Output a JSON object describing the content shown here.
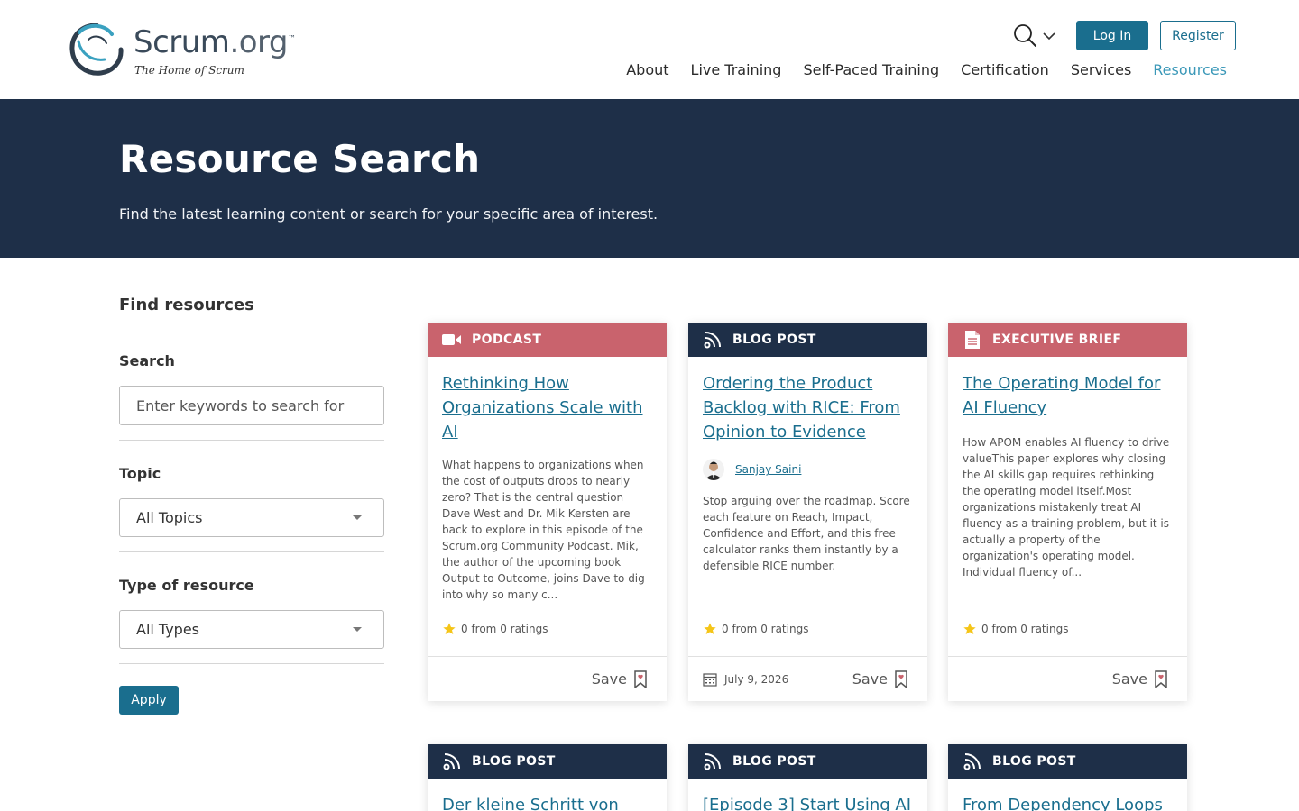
{
  "header": {
    "logo": {
      "brand": "Scrum",
      "suffix": ".org",
      "tm": "™",
      "tagline": "The Home of Scrum"
    },
    "login_label": "Log In",
    "register_label": "Register",
    "nav": [
      {
        "label": "About"
      },
      {
        "label": "Live Training"
      },
      {
        "label": "Self-Paced Training"
      },
      {
        "label": "Certification"
      },
      {
        "label": "Services"
      },
      {
        "label": "Resources",
        "active": true
      }
    ]
  },
  "hero": {
    "title": "Resource Search",
    "subtitle": "Find the latest learning content or search for your specific area of interest."
  },
  "sidebar": {
    "title": "Find resources",
    "search_label": "Search",
    "search_placeholder": "Enter keywords to search for",
    "topic_label": "Topic",
    "topic_value": "All Topics",
    "type_label": "Type of resource",
    "type_value": "All Types",
    "apply_label": "Apply"
  },
  "cards": [
    {
      "type": "PODCAST",
      "icon": "video-camera-icon",
      "title": "Rethinking How Organizations Scale with AI",
      "description": "What happens to organizations when the cost of outputs drops to nearly zero? That is the central question Dave West and Dr. Mik Kersten are back to explore in this episode of the Scrum.org Community Podcast. Mik, the author of the upcoming book Output to Outcome, joins Dave to dig into why so many c...",
      "rating": "0 from 0 ratings",
      "save_label": "Save"
    },
    {
      "type": "BLOG POST",
      "icon": "rss-icon",
      "title": "Ordering the Product Backlog with RICE: From Opinion to Evidence",
      "author": "Sanjay Saini",
      "description": "Stop arguing over the roadmap. Score each feature on Reach, Impact, Confidence and Effort, and this free calculator ranks them instantly by a defensible RICE number.",
      "rating": "0 from 0 ratings",
      "date": "July 9, 2026",
      "save_label": "Save"
    },
    {
      "type": "EXECUTIVE BRIEF",
      "icon": "document-icon",
      "title": "The Operating Model for AI Fluency",
      "description": "How APOM enables AI fluency to drive valueThis paper explores why closing the AI skills gap requires rethinking the operating model itself.Most organizations mistakenly treat AI fluency as a training problem, but it is actually a property of the organization's operating model. Individual fluency of...",
      "rating": "0 from 0 ratings",
      "save_label": "Save"
    },
    {
      "type": "BLOG POST",
      "icon": "rss-icon",
      "title": "Der kleine Schritt von"
    },
    {
      "type": "BLOG POST",
      "icon": "rss-icon",
      "title": "[Episode 3] Start Using AI"
    },
    {
      "type": "BLOG POST",
      "icon": "rss-icon",
      "title": "From Dependency Loops"
    }
  ],
  "colors": {
    "accent": "#1a6e8e",
    "hero_bg": "#1e2f48",
    "pink_head": "#c9636d",
    "active_nav": "#3b98b8"
  }
}
